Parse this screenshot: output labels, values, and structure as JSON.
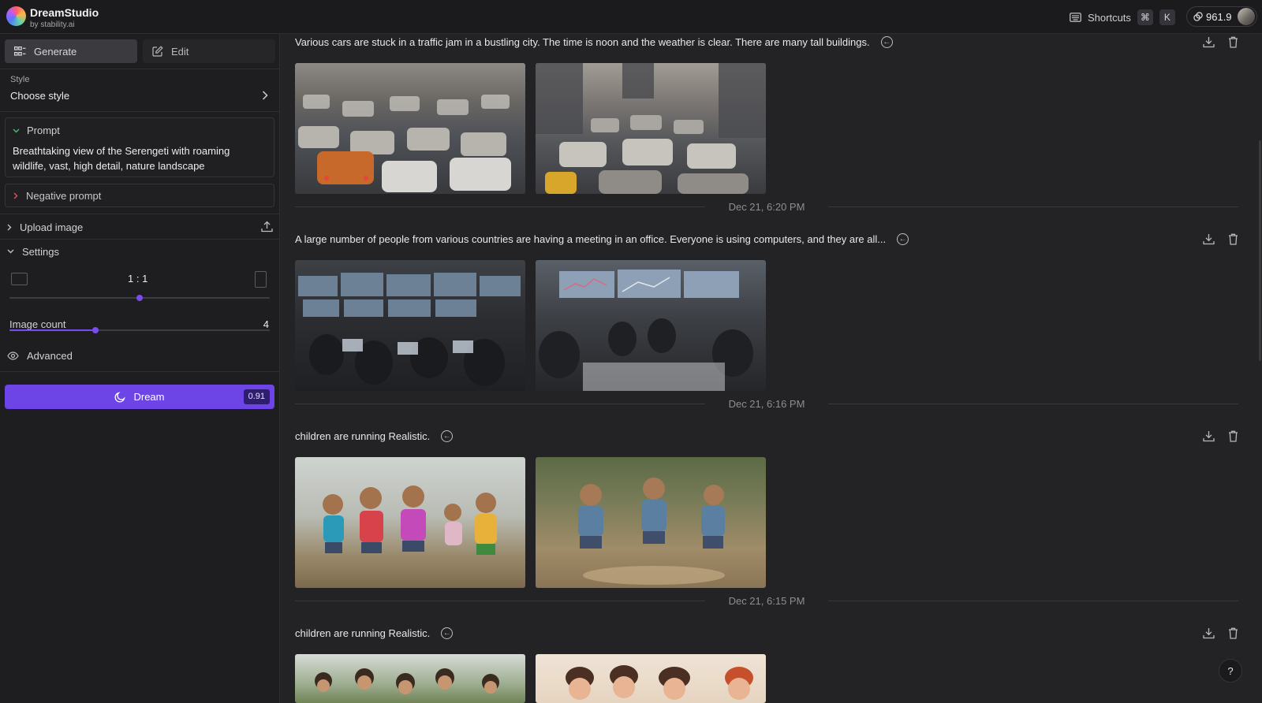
{
  "app": {
    "name": "DreamStudio",
    "byline": "by stability.ai"
  },
  "header": {
    "shortcuts_label": "Shortcuts",
    "shortcut_keys": [
      "⌘",
      "K"
    ],
    "credits": "961.9"
  },
  "sidebar": {
    "tabs": [
      {
        "label": "Generate",
        "active": true
      },
      {
        "label": "Edit",
        "active": false
      }
    ],
    "style": {
      "label": "Style",
      "value": "Choose style"
    },
    "prompt": {
      "label": "Prompt",
      "text": "Breathtaking view of the Serengeti with roaming wildlife, vast, high detail, nature landscape"
    },
    "negative_prompt_label": "Negative prompt",
    "upload_image_label": "Upload image",
    "settings_label": "Settings",
    "aspect_ratio": {
      "value": "1 : 1",
      "slider_fraction": 0.5
    },
    "image_count": {
      "label": "Image count",
      "value": "4",
      "slider_fraction": 0.33
    },
    "advanced_label": "Advanced",
    "dream_button": {
      "label": "Dream",
      "cost": "0.91"
    }
  },
  "feed": [
    {
      "prompt": "Various cars are stuck in a traffic jam in a bustling city. The time is noon and the weather is clear. There are many tall buildings.",
      "images": [
        "traffic-jam-image-1",
        "traffic-jam-image-2"
      ],
      "date": "Dec 21, 6:20 PM"
    },
    {
      "prompt": "A large number of people from various countries are having a meeting in an office. Everyone is using computers, and they are all...",
      "images": [
        "office-meeting-image-1",
        "office-meeting-image-2"
      ],
      "date": "Dec 21, 6:16 PM"
    },
    {
      "prompt": "children are running Realistic.",
      "images": [
        "children-running-image-1",
        "children-running-image-2"
      ],
      "date": "Dec 21, 6:15 PM"
    },
    {
      "prompt": "children are running Realistic.",
      "images": [
        "children-running-image-3",
        "children-running-image-4"
      ],
      "date": ""
    }
  ],
  "help_label": "?",
  "colors": {
    "accent": "#6d44e6",
    "background": "#232325",
    "sidebar": "#1e1e20"
  }
}
